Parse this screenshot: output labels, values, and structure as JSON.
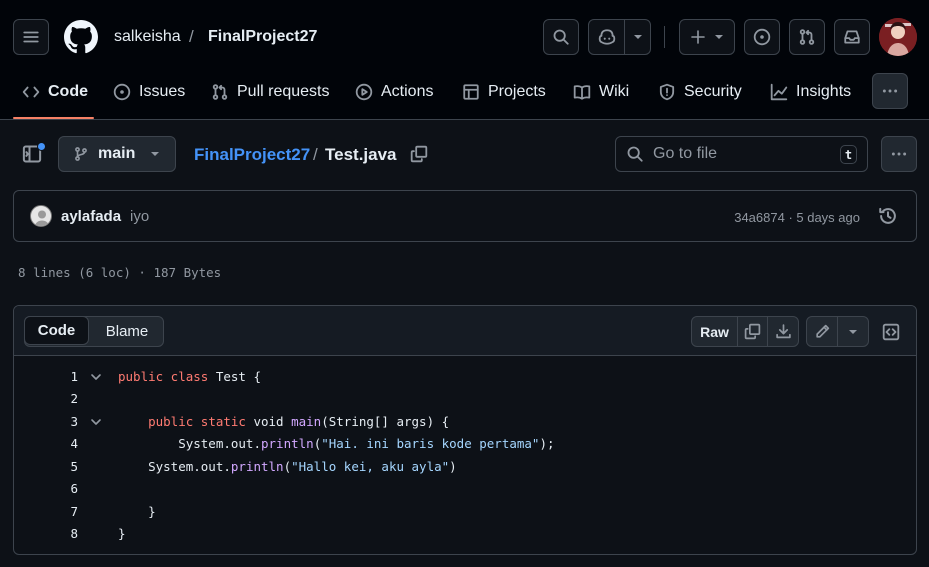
{
  "header": {
    "owner": "salkeisha",
    "separator": "/",
    "repo": "FinalProject27"
  },
  "tabs": [
    {
      "label": "Code",
      "icon": "code-icon",
      "selected": true
    },
    {
      "label": "Issues",
      "icon": "issue-opened-icon"
    },
    {
      "label": "Pull requests",
      "icon": "git-pull-request-icon"
    },
    {
      "label": "Actions",
      "icon": "play-icon"
    },
    {
      "label": "Projects",
      "icon": "table-icon"
    },
    {
      "label": "Wiki",
      "icon": "book-icon"
    },
    {
      "label": "Security",
      "icon": "shield-icon"
    },
    {
      "label": "Insights",
      "icon": "graph-icon"
    }
  ],
  "file_header": {
    "branch": "main",
    "path_repo": "FinalProject27",
    "path_sep": "/",
    "file_name": "Test.java",
    "goto_placeholder": "Go to file",
    "goto_shortcut": "t"
  },
  "commit": {
    "author": "aylafada",
    "message": "iyo",
    "meta": "34a6874 · 5 days ago"
  },
  "file_info": "8 lines (6 loc) · 187 Bytes",
  "code_view": {
    "tab_code": "Code",
    "tab_blame": "Blame",
    "raw_label": "Raw"
  },
  "code_lines": [
    {
      "n": "1",
      "fold": true,
      "tokens": [
        [
          "kw",
          "public class"
        ],
        [
          "cl",
          " Test {"
        ]
      ]
    },
    {
      "n": "2",
      "fold": false,
      "tokens": []
    },
    {
      "n": "3",
      "fold": true,
      "tokens": [
        [
          "cl",
          "    "
        ],
        [
          "kw",
          "public static"
        ],
        [
          "cl",
          " void "
        ],
        [
          "fn",
          "main"
        ],
        [
          "cl",
          "(String[] args) {"
        ]
      ]
    },
    {
      "n": "4",
      "fold": false,
      "tokens": [
        [
          "cl",
          "        System.out."
        ],
        [
          "fn",
          "println"
        ],
        [
          "cl",
          "("
        ],
        [
          "str",
          "\"Hai. ini baris kode pertama\""
        ],
        [
          "cl",
          ");"
        ]
      ]
    },
    {
      "n": "5",
      "fold": false,
      "tokens": [
        [
          "cl",
          "    System.out."
        ],
        [
          "fn",
          "println"
        ],
        [
          "cl",
          "("
        ],
        [
          "str",
          "\"Hallo kei, aku ayla\""
        ],
        [
          "cl",
          ")"
        ]
      ]
    },
    {
      "n": "6",
      "fold": false,
      "tokens": []
    },
    {
      "n": "7",
      "fold": false,
      "tokens": [
        [
          "cl",
          "    }"
        ]
      ]
    },
    {
      "n": "8",
      "fold": false,
      "tokens": [
        [
          "cl",
          "}"
        ]
      ]
    }
  ],
  "colors": {
    "background": "#0d1117",
    "header_bg": "#010409",
    "accent_underline": "#f78166",
    "link": "#4493f8",
    "keyword": "#ff7b72",
    "function": "#d2a8ff",
    "string": "#a5d6ff"
  }
}
